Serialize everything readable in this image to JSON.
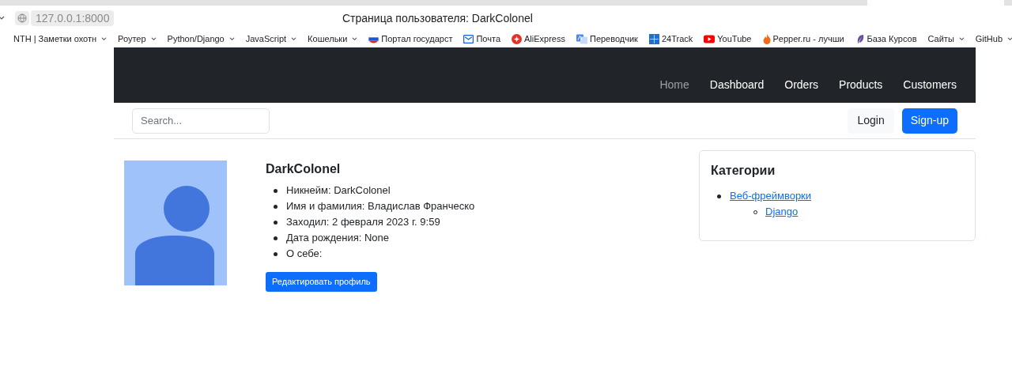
{
  "browser": {
    "url": "127.0.0.1:8000",
    "title": "Страница пользователя: DarkColonel",
    "bookmarks": [
      {
        "label": "NTH | Заметки охотн",
        "kind": "folder",
        "dropdown": true
      },
      {
        "label": "Роутер",
        "kind": "folder",
        "dropdown": true
      },
      {
        "label": "Python/Django",
        "kind": "folder",
        "dropdown": true
      },
      {
        "label": "JavaScript",
        "kind": "folder",
        "dropdown": true
      },
      {
        "label": "Кошельки",
        "kind": "folder",
        "dropdown": true
      },
      {
        "label": "Портал государст",
        "kind": "flag",
        "dropdown": false
      },
      {
        "label": "Почта",
        "kind": "mail",
        "dropdown": false
      },
      {
        "label": "AliExpress",
        "kind": "star",
        "dropdown": false
      },
      {
        "label": "Переводчик",
        "kind": "translate",
        "dropdown": false
      },
      {
        "label": "24Track",
        "kind": "grid",
        "dropdown": false
      },
      {
        "label": "YouTube",
        "kind": "play",
        "dropdown": false
      },
      {
        "label": "Pepper.ru - лучши",
        "kind": "flame",
        "dropdown": false
      },
      {
        "label": "База Курсов",
        "kind": "feather",
        "dropdown": false
      },
      {
        "label": "Сайты",
        "kind": "folder",
        "dropdown": true
      },
      {
        "label": "GitHub",
        "kind": "folder",
        "dropdown": true
      }
    ]
  },
  "navbar": {
    "links": [
      {
        "label": "Home",
        "muted": true
      },
      {
        "label": "Dashboard",
        "muted": false
      },
      {
        "label": "Orders",
        "muted": false
      },
      {
        "label": "Products",
        "muted": false
      },
      {
        "label": "Customers",
        "muted": false
      }
    ]
  },
  "toolbar": {
    "search": {
      "placeholder": "Search..."
    },
    "login": "Login",
    "signup": "Sign-up"
  },
  "profile": {
    "username": "DarkColonel",
    "details": [
      "Никнейм: DarkColonel",
      "Имя и фамилия: Владислав Франческо",
      "Заходил: 2 февраля 2023 г. 9:59",
      "Дата рождения: None",
      "О себе:"
    ],
    "edit_button": "Редактировать профиль"
  },
  "categories": {
    "title": "Категории",
    "items": [
      {
        "label": "Веб-фреймворки",
        "children": [
          {
            "label": "Django"
          }
        ]
      }
    ]
  }
}
